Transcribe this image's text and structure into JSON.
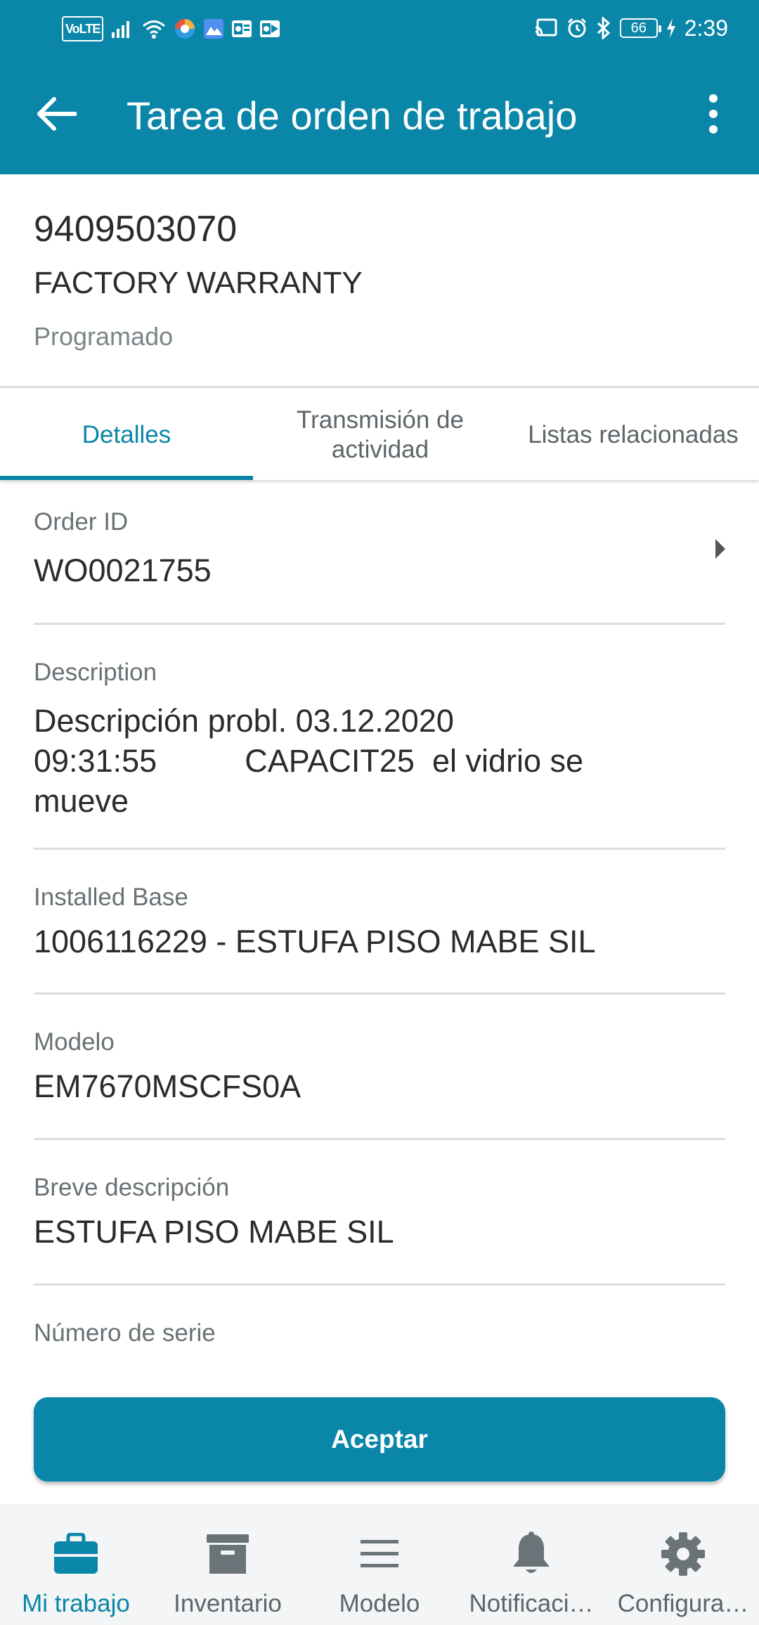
{
  "status_bar": {
    "left_icons": [
      "volte-icon",
      "signal-icon",
      "wifi-icon",
      "browser-icon",
      "gallery-icon",
      "outlook-icon",
      "outlook-icon"
    ],
    "volte_label": "VoLTE",
    "right_icons": [
      "cast-icon",
      "alarm-icon",
      "bluetooth-icon",
      "battery-icon",
      "charging-icon"
    ],
    "battery": "66",
    "time": "2:39"
  },
  "app_bar": {
    "title": "Tarea de orden de trabajo",
    "back_icon": "arrow-back-icon",
    "menu_icon": "more-vert-icon"
  },
  "header": {
    "number": "9409503070",
    "type": "FACTORY WARRANTY",
    "status": "Programado"
  },
  "tabs": [
    {
      "label": "Detalles",
      "active": true
    },
    {
      "label": "Transmisión de\nactividad",
      "active": false
    },
    {
      "label": "Listas relacionadas",
      "active": false
    }
  ],
  "fields": {
    "order_id": {
      "label": "Order ID",
      "value": "WO0021755"
    },
    "description": {
      "label": "Description",
      "value": "Descripción probl. 03.12.2020\n09:31:55          CAPACIT25  el vidrio se\nmueve"
    },
    "installed_base": {
      "label": "Installed Base",
      "value": "1006116229 - ESTUFA PISO MABE SIL"
    },
    "modelo": {
      "label": "Modelo",
      "value": "EM7670MSCFS0A"
    },
    "breve_descripcion": {
      "label": "Breve descripción",
      "value": "ESTUFA PISO MABE SIL"
    },
    "numero_serie": {
      "label": "Número de serie",
      "value": ""
    }
  },
  "accept_button": {
    "label": "Aceptar"
  },
  "bottom_nav": [
    {
      "label": "Mi trabajo",
      "icon": "briefcase-icon",
      "active": true
    },
    {
      "label": "Inventario",
      "icon": "archive-box-icon",
      "active": false
    },
    {
      "label": "Modelo",
      "icon": "menu-lines-icon",
      "active": false
    },
    {
      "label": "Notificaci…",
      "icon": "bell-icon",
      "active": false
    },
    {
      "label": "Configura…",
      "icon": "gear-icon",
      "active": false
    }
  ],
  "colors": {
    "primary": "#0a86a8",
    "divider": "#d6dee2",
    "nav_background": "#f3f5f6"
  }
}
